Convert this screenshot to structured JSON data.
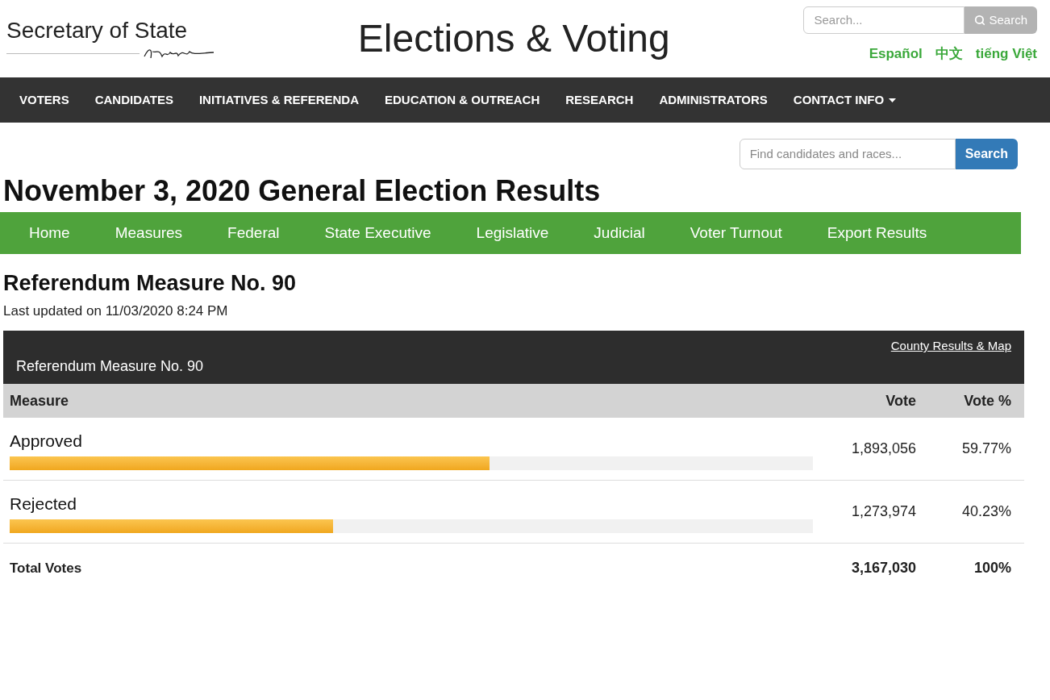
{
  "header": {
    "logo_text": "Secretary of State",
    "site_title": "Elections & Voting",
    "search": {
      "placeholder": "Search...",
      "button": "Search"
    },
    "languages": [
      "Español",
      "中文",
      "tiếng Việt"
    ]
  },
  "main_nav": [
    {
      "label": "VOTERS",
      "dropdown": false
    },
    {
      "label": "CANDIDATES",
      "dropdown": false
    },
    {
      "label": "INITIATIVES & REFERENDA",
      "dropdown": false
    },
    {
      "label": "EDUCATION & OUTREACH",
      "dropdown": false
    },
    {
      "label": "RESEARCH",
      "dropdown": false
    },
    {
      "label": "ADMINISTRATORS",
      "dropdown": false
    },
    {
      "label": "CONTACT INFO",
      "dropdown": true
    }
  ],
  "race_search": {
    "placeholder": "Find candidates and races...",
    "button": "Search"
  },
  "page_title": "November 3, 2020 General Election Results",
  "results_nav": [
    "Home",
    "Measures",
    "Federal",
    "State Executive",
    "Legislative",
    "Judicial",
    "Voter Turnout",
    "Export Results"
  ],
  "race": {
    "title": "Referendum Measure No. 90",
    "updated": "Last updated on 11/03/2020 8:24 PM",
    "table": {
      "caption": "Referendum Measure No. 90",
      "link": "County Results & Map",
      "columns": [
        "Measure",
        "Vote",
        "Vote %"
      ],
      "rows": [
        {
          "name": "Approved",
          "level": 0.5977,
          "vote": "1,893,056",
          "percent": "59.77%"
        },
        {
          "name": "Rejected",
          "level": 0.4023,
          "vote": "1,273,974",
          "percent": "40.23%"
        }
      ],
      "total": {
        "label": "Total Votes",
        "vote": "3,167,030",
        "percent": "100%"
      }
    }
  }
}
